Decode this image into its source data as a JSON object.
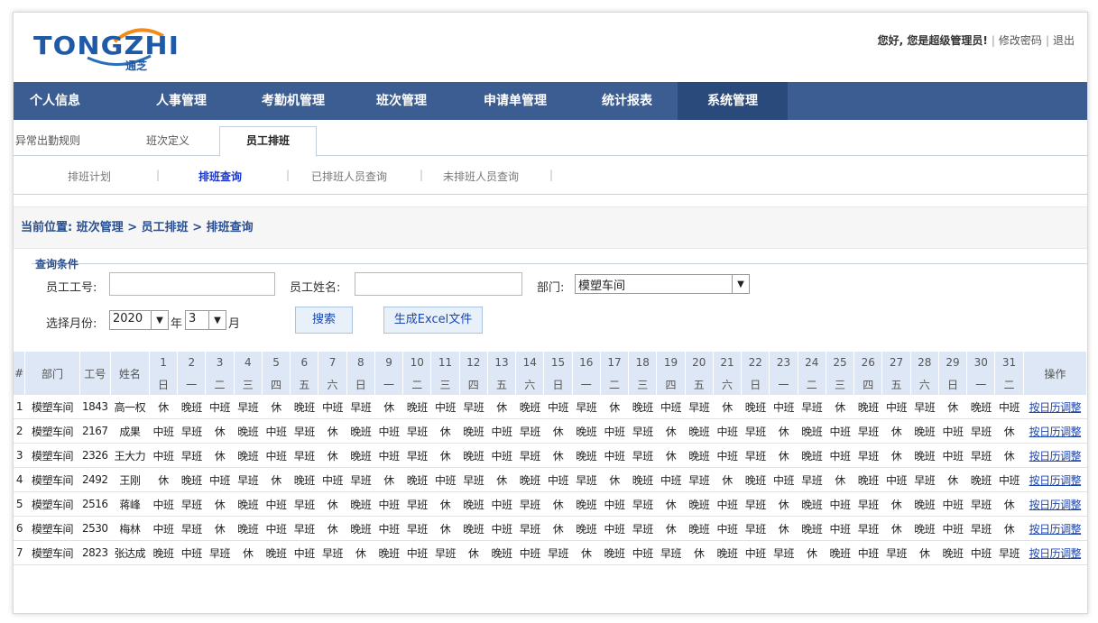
{
  "logo": {
    "brand": "TONGZHI",
    "chinese": "通芝"
  },
  "user_bar": {
    "greeting": "您好, 您是超级管理员!",
    "change_password": "修改密码",
    "logout": "退出"
  },
  "nav": [
    "个人信息",
    "人事管理",
    "考勤机管理",
    "班次管理",
    "申请单管理",
    "统计报表",
    "系统管理"
  ],
  "tabs": [
    "异常出勤规则",
    "班次定义",
    "员工排班"
  ],
  "subtabs": [
    "排班计划",
    "排班查询",
    "已排班人员查询",
    "未排班人员查询"
  ],
  "breadcrumb": "当前位置: 班次管理 > 员工排班 > 排班查询",
  "query": {
    "title": "查询条件",
    "emp_no_label": "员工工号:",
    "emp_no_value": "",
    "emp_name_label": "员工姓名:",
    "emp_name_value": "",
    "dept_label": "部门:",
    "dept_value": "模塑车间",
    "month_label": "选择月份:",
    "year_value": "2020",
    "year_unit": "年",
    "month_value": "3",
    "month_unit": "月",
    "search_label": "搜索",
    "excel_label": "生成Excel文件"
  },
  "table": {
    "headers": {
      "index": "#",
      "dept": "部门",
      "emp_no": "工号",
      "name": "姓名",
      "op": "操作"
    },
    "days": [
      "1",
      "2",
      "3",
      "4",
      "5",
      "6",
      "7",
      "8",
      "9",
      "10",
      "11",
      "12",
      "13",
      "14",
      "15",
      "16",
      "17",
      "18",
      "19",
      "20",
      "21",
      "22",
      "23",
      "24",
      "25",
      "26",
      "27",
      "28",
      "29",
      "30",
      "31"
    ],
    "weekdays": [
      "日",
      "一",
      "二",
      "三",
      "四",
      "五",
      "六",
      "日",
      "一",
      "二",
      "三",
      "四",
      "五",
      "六",
      "日",
      "一",
      "二",
      "三",
      "四",
      "五",
      "六",
      "日",
      "一",
      "二",
      "三",
      "四",
      "五",
      "六",
      "日",
      "一",
      "二"
    ],
    "op_label": "按日历调整",
    "rows": [
      {
        "idx": "1",
        "dept": "模塑车间",
        "emp_no": "1843",
        "name": "高一权",
        "shifts": [
          "休",
          "晚班",
          "中班",
          "早班",
          "休",
          "晚班",
          "中班",
          "早班",
          "休",
          "晚班",
          "中班",
          "早班",
          "休",
          "晚班",
          "中班",
          "早班",
          "休",
          "晚班",
          "中班",
          "早班",
          "休",
          "晚班",
          "中班",
          "早班",
          "休",
          "晚班",
          "中班",
          "早班",
          "休",
          "晚班",
          "中班"
        ]
      },
      {
        "idx": "2",
        "dept": "模塑车间",
        "emp_no": "2167",
        "name": "成果",
        "shifts": [
          "中班",
          "早班",
          "休",
          "晚班",
          "中班",
          "早班",
          "休",
          "晚班",
          "中班",
          "早班",
          "休",
          "晚班",
          "中班",
          "早班",
          "休",
          "晚班",
          "中班",
          "早班",
          "休",
          "晚班",
          "中班",
          "早班",
          "休",
          "晚班",
          "中班",
          "早班",
          "休",
          "晚班",
          "中班",
          "早班",
          "休"
        ]
      },
      {
        "idx": "3",
        "dept": "模塑车间",
        "emp_no": "2326",
        "name": "王大力",
        "shifts": [
          "中班",
          "早班",
          "休",
          "晚班",
          "中班",
          "早班",
          "休",
          "晚班",
          "中班",
          "早班",
          "休",
          "晚班",
          "中班",
          "早班",
          "休",
          "晚班",
          "中班",
          "早班",
          "休",
          "晚班",
          "中班",
          "早班",
          "休",
          "晚班",
          "中班",
          "早班",
          "休",
          "晚班",
          "中班",
          "早班",
          "休"
        ]
      },
      {
        "idx": "4",
        "dept": "模塑车间",
        "emp_no": "2492",
        "name": "王刚",
        "shifts": [
          "休",
          "晚班",
          "中班",
          "早班",
          "休",
          "晚班",
          "中班",
          "早班",
          "休",
          "晚班",
          "中班",
          "早班",
          "休",
          "晚班",
          "中班",
          "早班",
          "休",
          "晚班",
          "中班",
          "早班",
          "休",
          "晚班",
          "中班",
          "早班",
          "休",
          "晚班",
          "中班",
          "早班",
          "休",
          "晚班",
          "中班"
        ]
      },
      {
        "idx": "5",
        "dept": "模塑车间",
        "emp_no": "2516",
        "name": "蒋峰",
        "shifts": [
          "中班",
          "早班",
          "休",
          "晚班",
          "中班",
          "早班",
          "休",
          "晚班",
          "中班",
          "早班",
          "休",
          "晚班",
          "中班",
          "早班",
          "休",
          "晚班",
          "中班",
          "早班",
          "休",
          "晚班",
          "中班",
          "早班",
          "休",
          "晚班",
          "中班",
          "早班",
          "休",
          "晚班",
          "中班",
          "早班",
          "休"
        ]
      },
      {
        "idx": "6",
        "dept": "模塑车间",
        "emp_no": "2530",
        "name": "梅林",
        "shifts": [
          "中班",
          "早班",
          "休",
          "晚班",
          "中班",
          "早班",
          "休",
          "晚班",
          "中班",
          "早班",
          "休",
          "晚班",
          "中班",
          "早班",
          "休",
          "晚班",
          "中班",
          "早班",
          "休",
          "晚班",
          "中班",
          "早班",
          "休",
          "晚班",
          "中班",
          "早班",
          "休",
          "晚班",
          "中班",
          "早班",
          "休"
        ]
      },
      {
        "idx": "7",
        "dept": "模塑车间",
        "emp_no": "2823",
        "name": "张达成",
        "shifts": [
          "晚班",
          "中班",
          "早班",
          "休",
          "晚班",
          "中班",
          "早班",
          "休",
          "晚班",
          "中班",
          "早班",
          "休",
          "晚班",
          "中班",
          "早班",
          "休",
          "晚班",
          "中班",
          "早班",
          "休",
          "晚班",
          "中班",
          "早班",
          "休",
          "晚班",
          "中班",
          "早班",
          "休",
          "晚班",
          "中班",
          "早班"
        ]
      }
    ]
  }
}
